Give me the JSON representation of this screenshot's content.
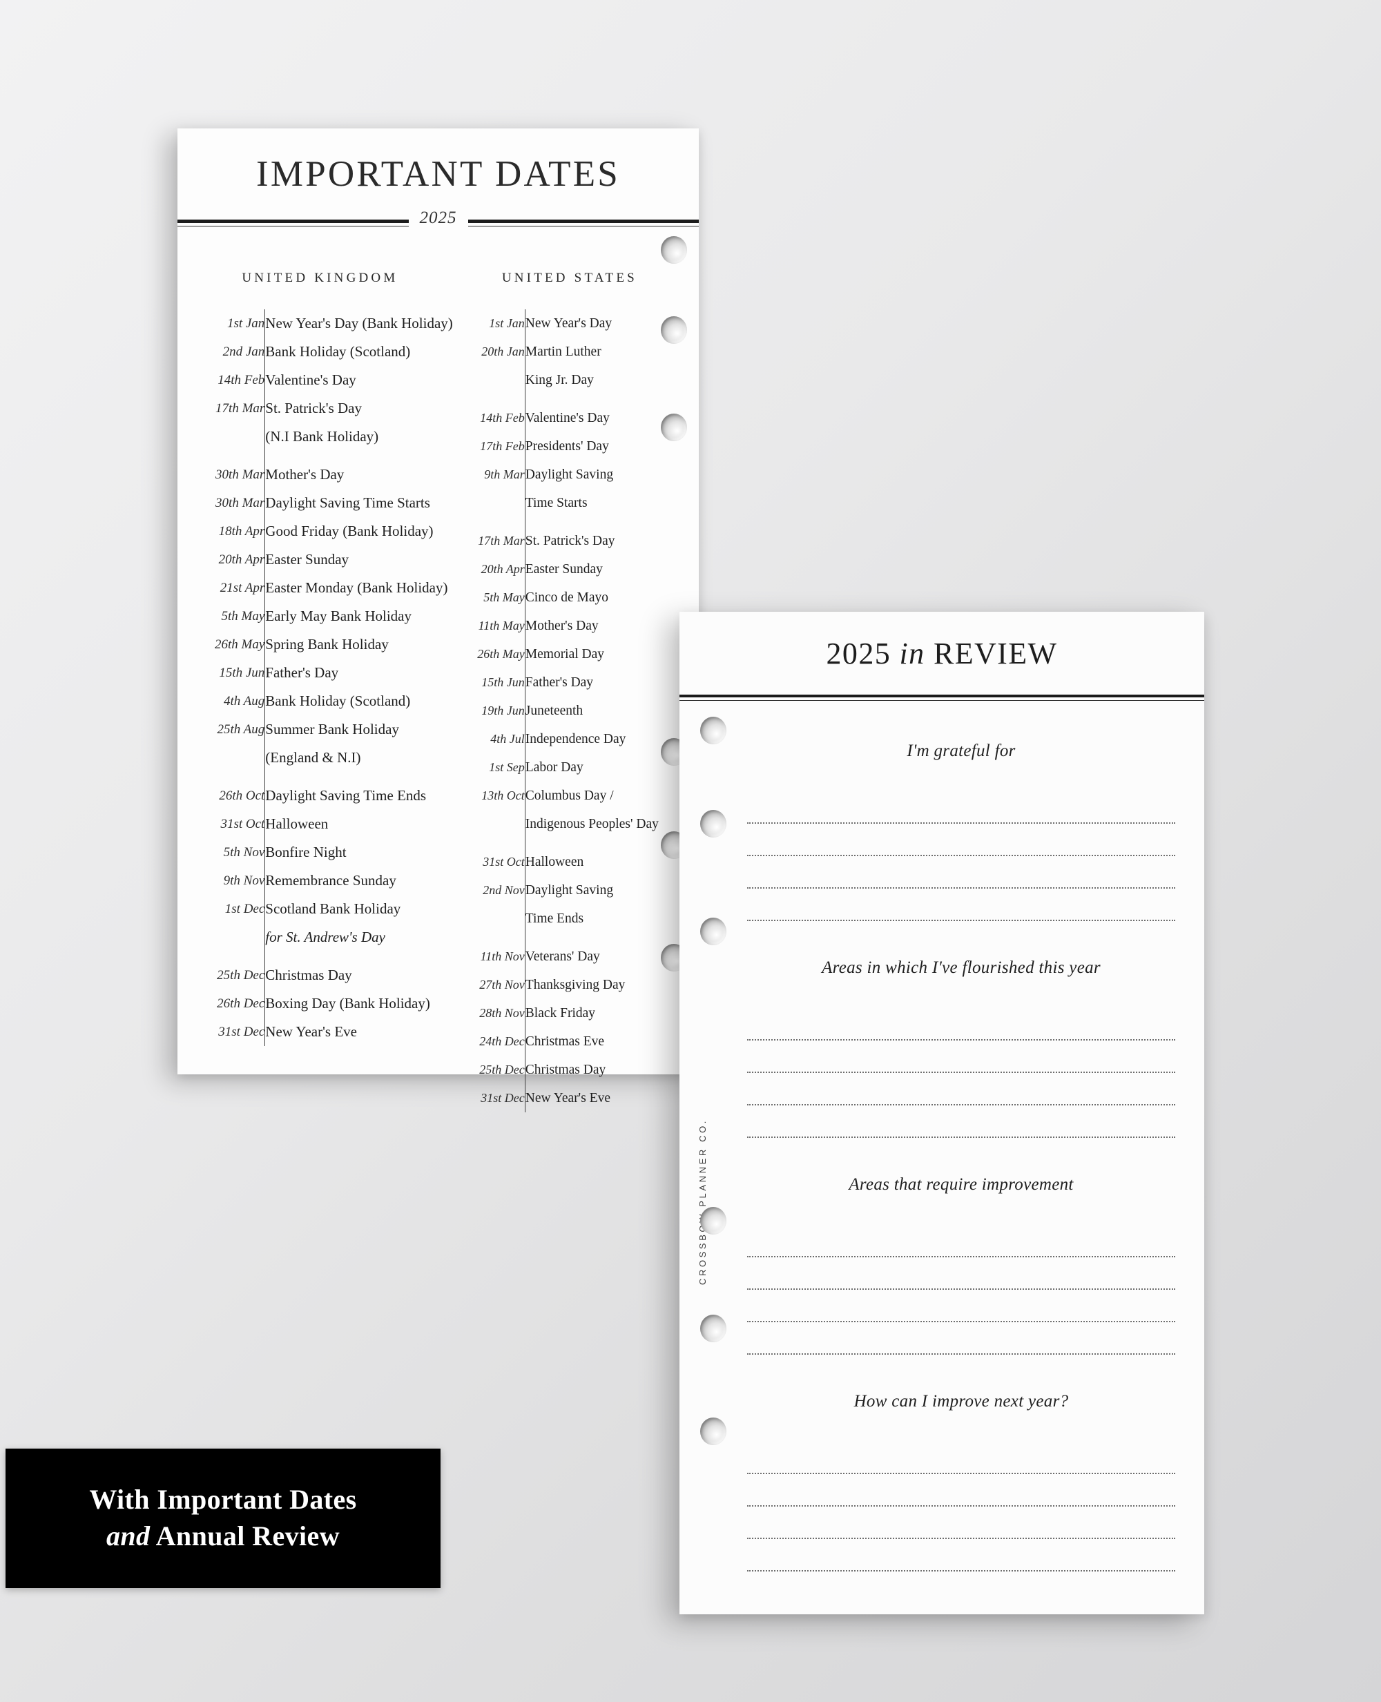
{
  "dates_page": {
    "title": "IMPORTANT DATES",
    "year": "2025",
    "uk": {
      "heading": "UNITED KINGDOM",
      "rows": [
        {
          "date": "1st Jan",
          "event": "New Year's Day (Bank Holiday)"
        },
        {
          "date": "2nd Jan",
          "event": "Bank Holiday (Scotland)"
        },
        {
          "date": "14th Feb",
          "event": "Valentine's Day"
        },
        {
          "date": "17th Mar",
          "event": "St. Patrick's Day"
        },
        {
          "date": "",
          "event": "(N.I Bank Holiday)"
        },
        {
          "date": "30th Mar",
          "event": "Mother's Day"
        },
        {
          "date": "30th Mar",
          "event": "Daylight Saving Time Starts"
        },
        {
          "date": "18th Apr",
          "event": "Good Friday (Bank Holiday)"
        },
        {
          "date": "20th Apr",
          "event": "Easter Sunday"
        },
        {
          "date": "21st Apr",
          "event": "Easter Monday (Bank Holiday)"
        },
        {
          "date": "5th May",
          "event": "Early May Bank Holiday"
        },
        {
          "date": "26th May",
          "event": "Spring Bank Holiday"
        },
        {
          "date": "15th Jun",
          "event": "Father's Day"
        },
        {
          "date": "4th Aug",
          "event": "Bank Holiday (Scotland)"
        },
        {
          "date": "25th Aug",
          "event": "Summer Bank Holiday"
        },
        {
          "date": "",
          "event": "(England & N.I)"
        },
        {
          "date": "26th Oct",
          "event": "Daylight Saving Time Ends"
        },
        {
          "date": "31st Oct",
          "event": "Halloween"
        },
        {
          "date": "5th Nov",
          "event": "Bonfire Night"
        },
        {
          "date": "9th Nov",
          "event": "Remembrance Sunday"
        },
        {
          "date": "1st Dec",
          "event": "Scotland Bank Holiday"
        },
        {
          "date": "",
          "event": "for St. Andrew's Day",
          "italic": true
        },
        {
          "date": "25th Dec",
          "event": "Christmas Day"
        },
        {
          "date": "26th Dec",
          "event": "Boxing Day (Bank Holiday)"
        },
        {
          "date": "31st Dec",
          "event": "New Year's Eve"
        }
      ]
    },
    "us": {
      "heading": "UNITED STATES",
      "rows": [
        {
          "date": "1st Jan",
          "event": "New Year's Day"
        },
        {
          "date": "20th Jan",
          "event": "Martin Luther"
        },
        {
          "date": "",
          "event": "King Jr. Day"
        },
        {
          "date": "14th Feb",
          "event": "Valentine's Day"
        },
        {
          "date": "17th Feb",
          "event": "Presidents' Day"
        },
        {
          "date": "9th Mar",
          "event": "Daylight Saving"
        },
        {
          "date": "",
          "event": "Time Starts"
        },
        {
          "date": "17th Mar",
          "event": "St. Patrick's Day"
        },
        {
          "date": "20th Apr",
          "event": "Easter Sunday"
        },
        {
          "date": "5th May",
          "event": "Cinco de Mayo"
        },
        {
          "date": "11th May",
          "event": "Mother's Day"
        },
        {
          "date": "26th May",
          "event": "Memorial Day"
        },
        {
          "date": "15th Jun",
          "event": "Father's Day"
        },
        {
          "date": "19th Jun",
          "event": "Juneteenth"
        },
        {
          "date": "4th Jul",
          "event": "Independence Day"
        },
        {
          "date": "1st Sep",
          "event": "Labor Day"
        },
        {
          "date": "13th Oct",
          "event": "Columbus Day /"
        },
        {
          "date": "",
          "event": "Indigenous Peoples' Day"
        },
        {
          "date": "31st Oct",
          "event": "Halloween"
        },
        {
          "date": "2nd Nov",
          "event": "Daylight Saving"
        },
        {
          "date": "",
          "event": "Time Ends"
        },
        {
          "date": "11th Nov",
          "event": "Veterans' Day"
        },
        {
          "date": "27th Nov",
          "event": "Thanksgiving Day"
        },
        {
          "date": "28th Nov",
          "event": "Black Friday"
        },
        {
          "date": "24th Dec",
          "event": "Christmas Eve"
        },
        {
          "date": "25th Dec",
          "event": "Christmas Day"
        },
        {
          "date": "31st Dec",
          "event": "New Year's Eve"
        }
      ]
    }
  },
  "review_page": {
    "title_year": "2025",
    "title_in": "in",
    "title_review": "REVIEW",
    "brand": "CROSSBOW PLANNER CO.",
    "sections": [
      {
        "prompt": "I'm grateful for",
        "lines": 4
      },
      {
        "prompt": "Areas in which I've flourished this year",
        "lines": 4
      },
      {
        "prompt": "Areas that require improvement",
        "lines": 4
      },
      {
        "prompt": "How can I improve next year?",
        "lines": 4
      }
    ]
  },
  "banner": {
    "line1": "With Important Dates",
    "line2_italic": "and",
    "line2_rest": " Annual Review"
  },
  "colors": {
    "paper": "#fdfdfd",
    "ink": "#1c1c1c",
    "banner_bg": "#000000",
    "banner_text": "#ffffff",
    "background": "#e6e6e7"
  }
}
